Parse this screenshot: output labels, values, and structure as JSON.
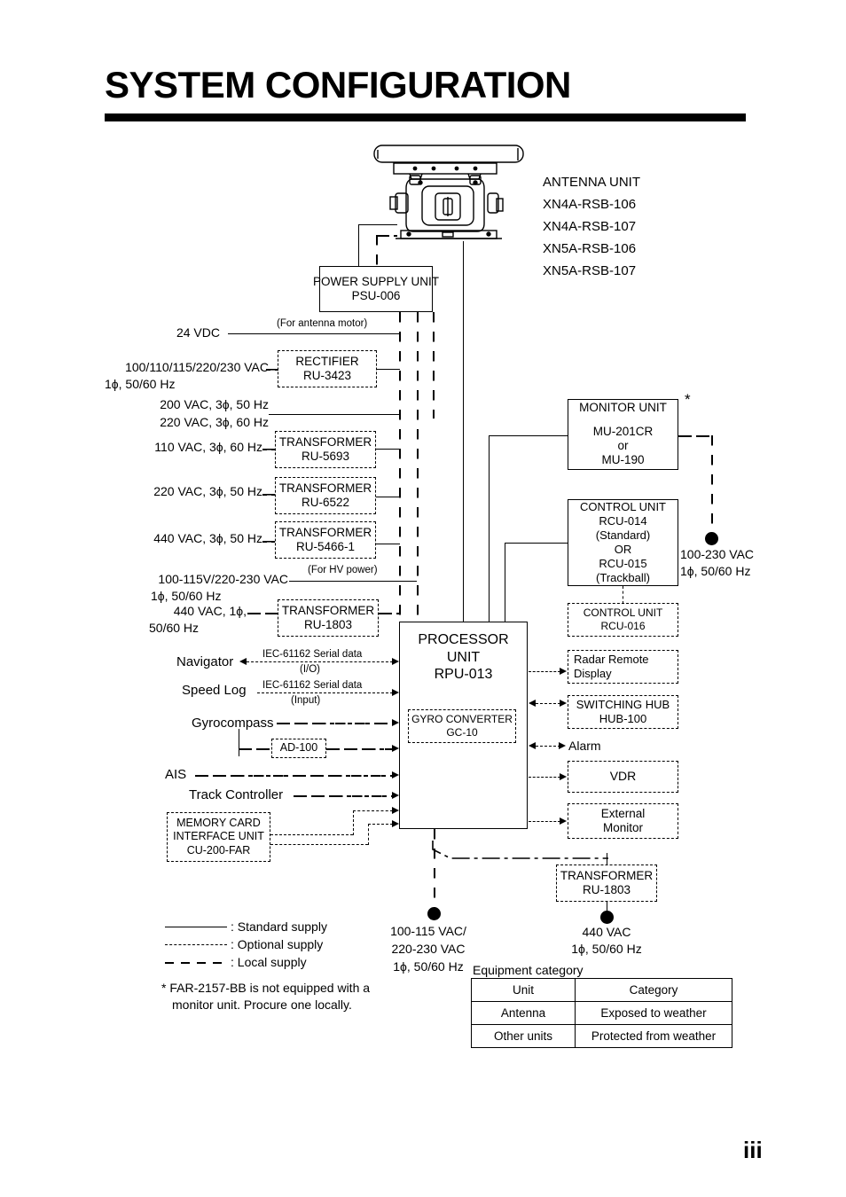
{
  "page": {
    "title": "SYSTEM CONFIGURATION",
    "page_number": "iii"
  },
  "antenna": {
    "heading": "ANTENNA UNIT",
    "models": [
      "XN4A-RSB-106",
      "XN4A-RSB-107",
      "XN5A-RSB-106",
      "XN5A-RSB-107"
    ]
  },
  "units": {
    "psu": {
      "line1": "POWER SUPPLY UNIT",
      "line2": "PSU-006"
    },
    "rectifier": {
      "line1": "RECTIFIER",
      "line2": "RU-3423"
    },
    "transformer_5693": {
      "line1": "TRANSFORMER",
      "line2": "RU-5693"
    },
    "transformer_6522": {
      "line1": "TRANSFORMER",
      "line2": "RU-6522"
    },
    "transformer_5466": {
      "line1": "TRANSFORMER",
      "line2": "RU-5466-1"
    },
    "transformer_1803_left": {
      "line1": "TRANSFORMER",
      "line2": "RU-1803"
    },
    "transformer_1803_bottom": {
      "line1": "TRANSFORMER",
      "line2": "RU-1803"
    },
    "processor": {
      "line1": "PROCESSOR",
      "line2": "UNIT",
      "line3": "RPU-013"
    },
    "gyro_converter": {
      "line1": "GYRO CONVERTER",
      "line2": "GC-10"
    },
    "monitor": {
      "line1": "MONITOR UNIT",
      "line2": "",
      "line3": "MU-201CR",
      "line4": "or",
      "line5": "MU-190"
    },
    "control": {
      "line1": "CONTROL UNIT",
      "line2": "RCU-014",
      "line3": "(Standard)",
      "line4": "OR",
      "line5": "RCU-015",
      "line6": "(Trackball)"
    },
    "control_016": {
      "line1": "CONTROL UNIT",
      "line2": "RCU-016"
    },
    "radar_remote": {
      "line1": "Radar Remote",
      "line2": "Display"
    },
    "switching_hub": {
      "line1": "SWITCHING HUB",
      "line2": "HUB-100"
    },
    "vdr": {
      "line1": "VDR"
    },
    "external_monitor": {
      "line1": "External",
      "line2": "Monitor"
    },
    "memory_card": {
      "line1": "MEMORY CARD",
      "line2": "INTERFACE UNIT",
      "line3": "CU-200-FAR"
    }
  },
  "labels": {
    "vdc_24": "24 VDC",
    "for_antenna_motor": "(For antenna motor)",
    "vac_rect_1": "100/110/115/220/230 VAC",
    "vac_rect_2": "1ϕ, 50/60 Hz",
    "vac_200": "200 VAC, 3ϕ, 50 Hz",
    "vac_220_60": "220 VAC, 3ϕ, 60 Hz",
    "vac_110": "110 VAC, 3ϕ, 60 Hz",
    "vac_220_50": "220 VAC, 3ϕ, 50 Hz",
    "vac_440_3ph": "440 VAC, 3ϕ, 50 Hz",
    "for_hv_power": "(For HV power)",
    "vac_hv_1": "100-115V/220-230 VAC",
    "vac_hv_2": "1ϕ, 50/60 Hz",
    "vac_440_1ph_1": "440 VAC, 1ϕ,",
    "vac_440_1ph_2": "50/60 Hz",
    "navigator": "Navigator",
    "nav_data_1": "IEC-61162 Serial data",
    "nav_data_2": "(I/O)",
    "speed_log": "Speed Log",
    "speed_data_1": "IEC-61162 Serial data",
    "speed_data_2": "(Input)",
    "gyrocompass": "Gyrocompass",
    "ad_100": "AD-100",
    "ais": "AIS",
    "track_controller": "Track Controller",
    "alarm": "Alarm",
    "asterisk": "★",
    "supply_100_230_1": "100-230 VAC",
    "supply_100_230_2": "1ϕ, 50/60 Hz",
    "supply_bottom_1": "100-115 VAC/",
    "supply_bottom_2": "220-230 VAC",
    "supply_bottom_3": "1ϕ, 50/60 Hz",
    "supply_440_1": "440 VAC",
    "supply_440_2": "1ϕ, 50/60 Hz"
  },
  "legend": {
    "items": [
      {
        "key": "solid",
        "text": ": Standard supply"
      },
      {
        "key": "dashed",
        "text": ": Optional supply"
      },
      {
        "key": "dashdot",
        "text": ": Local supply"
      }
    ]
  },
  "footnote": {
    "line1": "* FAR-2157-BB is not equipped with a",
    "line2": "monitor unit. Procure one locally."
  },
  "equipment_category": {
    "title": "Equipment category",
    "headers": [
      "Unit",
      "Category"
    ],
    "rows": [
      [
        "Antenna",
        "Exposed to weather"
      ],
      [
        "Other units",
        "Protected from weather"
      ]
    ]
  },
  "colors": {
    "ink": "#000000",
    "paper": "#ffffff"
  }
}
